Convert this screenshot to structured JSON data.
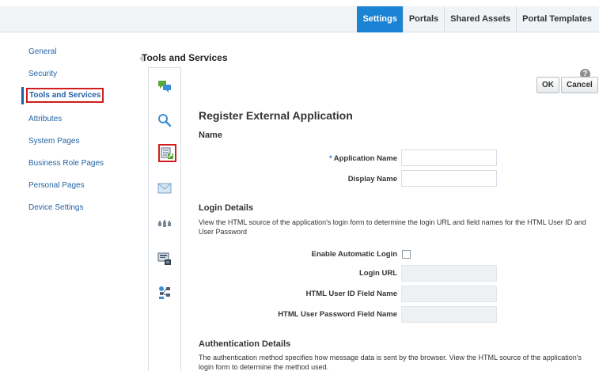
{
  "top_tabs": [
    "Settings",
    "Portals",
    "Shared Assets",
    "Portal Templates"
  ],
  "left_nav": {
    "items": [
      "General",
      "Security",
      "Tools and Services",
      "Attributes",
      "System Pages",
      "Business Role Pages",
      "Personal Pages",
      "Device Settings"
    ],
    "selected": "Tools and Services"
  },
  "section_title": "Tools and Services",
  "icon_strip": [
    "chat-icon",
    "search-icon",
    "external-application-icon",
    "mail-icon",
    "people-connections-icon",
    "presence-icon",
    "workflow-icon"
  ],
  "actions": {
    "ok": "OK",
    "cancel": "Cancel",
    "help": "?"
  },
  "form": {
    "title": "Register External Application",
    "name_section": "Name",
    "app_name_label": "Application Name",
    "required_mark": "*",
    "display_name_label": "Display Name",
    "login_section": "Login Details",
    "login_desc": "View the HTML source of the application's login form to determine the login URL and field names for the HTML User ID and User Password",
    "enable_auto_login_label": "Enable Automatic Login",
    "login_url_label": "Login URL",
    "html_user_id_label": "HTML User ID Field Name",
    "html_password_label": "HTML User Password Field Name",
    "auth_section": "Authentication Details",
    "auth_desc": "The authentication method specifies how message data is sent by the browser. View the HTML source of the application's login form to determine the method used."
  }
}
